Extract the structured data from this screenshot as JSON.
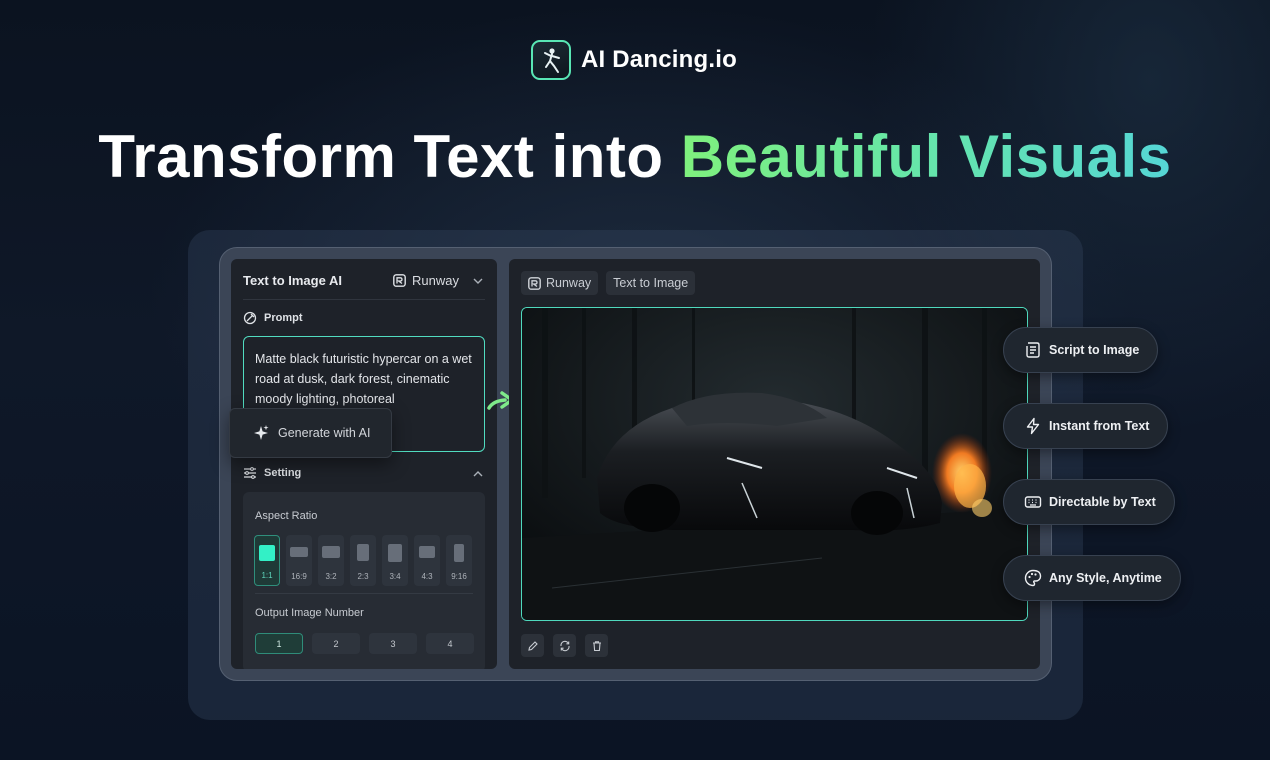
{
  "brand": {
    "name": "AI Dancing.io",
    "icon": "dancer-logo-icon"
  },
  "headline": {
    "part1": "Transform Text into",
    "part2": "Beautiful Visuals"
  },
  "left_panel": {
    "title": "Text to Image AI",
    "model": "Runway",
    "prompt_label": "Prompt",
    "prompt_text": "Matte black futuristic hypercar on a wet road at dusk, dark forest, cinematic moody lighting, photoreal",
    "generate_label": "Generate with AI",
    "setting_label": "Setting",
    "aspect_ratio_label": "Aspect Ratio",
    "aspect_ratios": [
      "1:1",
      "16:9",
      "3:2",
      "2:3",
      "3:4",
      "4:3",
      "9:16"
    ],
    "aspect_ratio_selected": "1:1",
    "output_number_label": "Output Image Number",
    "output_numbers": [
      "1",
      "2",
      "3",
      "4"
    ],
    "output_number_selected": "1"
  },
  "right_panel": {
    "tags": [
      "Runway",
      "Text to Image"
    ],
    "actions": [
      "edit-icon",
      "refresh-icon",
      "delete-icon"
    ]
  },
  "features": [
    {
      "label": "Script to Image",
      "icon": "script-icon"
    },
    {
      "label": "Instant from Text",
      "icon": "lightning-icon"
    },
    {
      "label": "Directable by Text",
      "icon": "keyboard-icon"
    },
    {
      "label": "Any Style, Anytime",
      "icon": "palette-icon"
    }
  ],
  "colors": {
    "accent": "#51dcc0",
    "gradient_start": "#7ff07d",
    "gradient_end": "#55d6d6"
  }
}
